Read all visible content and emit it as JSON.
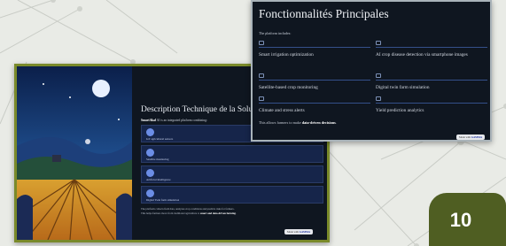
{
  "colors": {
    "background": "#e9ebe6",
    "slide_bg": "#0f1620",
    "accent_olive": "#4f5e22",
    "card_blue": "#16254a",
    "icon_blue": "#6b8de6"
  },
  "slide_left": {
    "title": "Description Technique de la Solution",
    "subtitle_strong": "SmartAkal",
    "subtitle_rest": " AI is an integrated platform combining:",
    "cards": [
      {
        "label": "IoT agricultural sensors",
        "icon": "sensor-icon"
      },
      {
        "label": "Satellite monitoring",
        "icon": "satellite-icon"
      },
      {
        "label": "Artificial Intelligence",
        "icon": "ai-icon"
      },
      {
        "label": "Digital Twin farm simulation",
        "icon": "twin-icon"
      }
    ],
    "footer_line1": "The platform collects field data, analyzes crop conditions and predicts risks for farmers.",
    "footer_line2_prefix": "This helps farmers move from traditional agriculture to ",
    "footer_line2_strong": "smart and data-driven farming",
    "footer_line2_suffix": ".",
    "watermark_prefix": "Made with ",
    "watermark_brand": "GAMMA"
  },
  "slide_right": {
    "title": "Fonctionnalités Principales",
    "subtitle": "The platform includes:",
    "features": [
      {
        "label": "Smart irrigation optimization",
        "icon": "water-icon"
      },
      {
        "label": "AI crop disease detection via smartphone images",
        "icon": "leaf-icon"
      },
      {
        "label": "Satellite-based crop monitoring",
        "icon": "satellite-icon"
      },
      {
        "label": "Digital twin farm simulation",
        "icon": "twin-icon"
      },
      {
        "label": "Climate and stress alerts",
        "icon": "alert-icon"
      },
      {
        "label": "Yield prediction analytics",
        "icon": "chart-icon"
      }
    ],
    "footer_prefix": "This allows farmers to make ",
    "footer_strong": "data-driven decisions",
    "footer_suffix": ".",
    "watermark_prefix": "Made with ",
    "watermark_brand": "GAMMA"
  },
  "page_number": "10"
}
